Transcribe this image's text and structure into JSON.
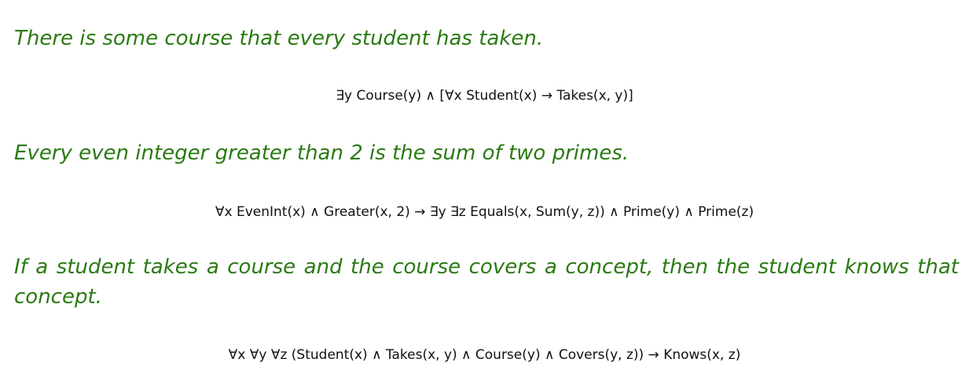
{
  "statements": [
    {
      "sentence": "There is some course that every student has taken.",
      "formula": "∃y Course(y) ∧ [∀x Student(x) → Takes(x, y)]"
    },
    {
      "sentence": "Every even integer greater than 2 is the sum of two primes.",
      "formula": "∀x EvenInt(x) ∧ Greater(x, 2) → ∃y ∃z Equals(x, Sum(y, z)) ∧ Prime(y) ∧ Prime(z)"
    },
    {
      "sentence": "If a student takes a course and the course covers a concept, then the student knows that concept.",
      "formula": "∀x ∀y ∀z (Student(x) ∧ Takes(x, y) ∧ Course(y) ∧ Covers(y, z)) → Knows(x, z)"
    }
  ],
  "colors": {
    "sentence": "#2a7a12",
    "formula": "#111111",
    "background": "#ffffff"
  }
}
